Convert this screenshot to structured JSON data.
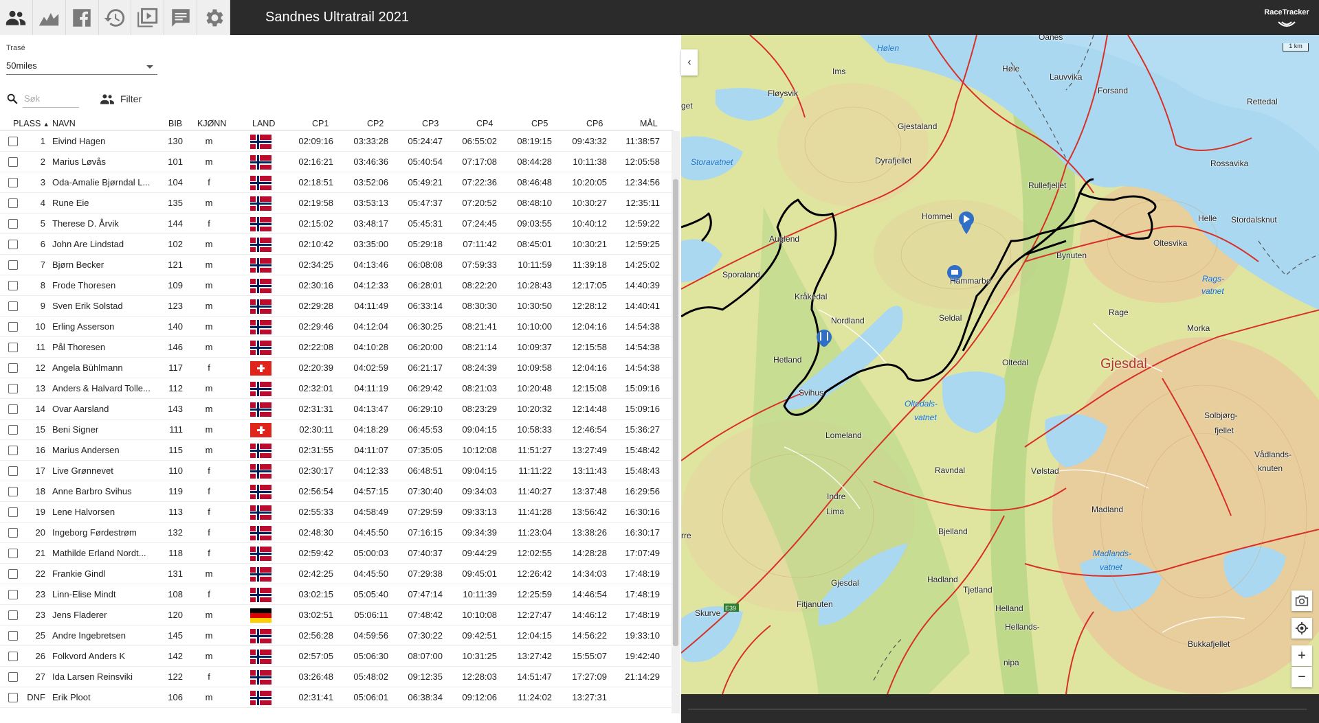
{
  "app": {
    "title": "Sandnes Ultratrail 2021",
    "brand": "RaceTracker"
  },
  "toolbar": {
    "icons": [
      "participants-icon",
      "elevation-chart-icon",
      "facebook-icon",
      "history-icon",
      "replay-icon",
      "chat-icon",
      "settings-icon"
    ]
  },
  "filters": {
    "trase_label": "Trasé",
    "trase_value": "50miles",
    "search_placeholder": "Søk",
    "filter_label": "Filter"
  },
  "table": {
    "headers": {
      "place": "PLASS",
      "name": "NAVN",
      "bib": "BIB",
      "sex": "KJØNN",
      "country": "LAND",
      "cp1": "CP1",
      "cp2": "CP2",
      "cp3": "CP3",
      "cp4": "CP4",
      "cp5": "CP5",
      "cp6": "CP6",
      "finish": "MÅL"
    },
    "rows": [
      {
        "place": "1",
        "name": "Eivind Hagen",
        "bib": "130",
        "sex": "m",
        "flag": "no",
        "cp1": "02:09:16",
        "cp2": "03:33:28",
        "cp3": "05:24:47",
        "cp4": "06:55:02",
        "cp5": "08:19:15",
        "cp6": "09:43:32",
        "finish": "11:38:57"
      },
      {
        "place": "2",
        "name": "Marius Løvås",
        "bib": "101",
        "sex": "m",
        "flag": "no",
        "cp1": "02:16:21",
        "cp2": "03:46:36",
        "cp3": "05:40:54",
        "cp4": "07:17:08",
        "cp5": "08:44:28",
        "cp6": "10:11:38",
        "finish": "12:05:58"
      },
      {
        "place": "3",
        "name": "Oda-Amalie Bjørndal L...",
        "bib": "104",
        "sex": "f",
        "flag": "no",
        "cp1": "02:18:51",
        "cp2": "03:52:06",
        "cp3": "05:49:21",
        "cp4": "07:22:36",
        "cp5": "08:46:48",
        "cp6": "10:20:05",
        "finish": "12:34:56"
      },
      {
        "place": "4",
        "name": "Rune Eie",
        "bib": "135",
        "sex": "m",
        "flag": "no",
        "cp1": "02:19:58",
        "cp2": "03:53:13",
        "cp3": "05:47:37",
        "cp4": "07:20:52",
        "cp5": "08:48:10",
        "cp6": "10:30:27",
        "finish": "12:35:11"
      },
      {
        "place": "5",
        "name": "Therese D. Årvik",
        "bib": "144",
        "sex": "f",
        "flag": "no",
        "cp1": "02:15:02",
        "cp2": "03:48:17",
        "cp3": "05:45:31",
        "cp4": "07:24:45",
        "cp5": "09:03:55",
        "cp6": "10:40:12",
        "finish": "12:59:22"
      },
      {
        "place": "6",
        "name": "John Are Lindstad",
        "bib": "102",
        "sex": "m",
        "flag": "no",
        "cp1": "02:10:42",
        "cp2": "03:35:00",
        "cp3": "05:29:18",
        "cp4": "07:11:42",
        "cp5": "08:45:01",
        "cp6": "10:30:21",
        "finish": "12:59:25"
      },
      {
        "place": "7",
        "name": "Bjørn Becker",
        "bib": "121",
        "sex": "m",
        "flag": "no",
        "cp1": "02:34:25",
        "cp2": "04:13:46",
        "cp3": "06:08:08",
        "cp4": "07:59:33",
        "cp5": "10:11:59",
        "cp6": "11:39:18",
        "finish": "14:25:02"
      },
      {
        "place": "8",
        "name": "Frode Thoresen",
        "bib": "109",
        "sex": "m",
        "flag": "no",
        "cp1": "02:30:16",
        "cp2": "04:12:33",
        "cp3": "06:28:01",
        "cp4": "08:22:20",
        "cp5": "10:28:43",
        "cp6": "12:17:05",
        "finish": "14:40:39"
      },
      {
        "place": "9",
        "name": "Sven Erik Solstad",
        "bib": "123",
        "sex": "m",
        "flag": "no",
        "cp1": "02:29:28",
        "cp2": "04:11:49",
        "cp3": "06:33:14",
        "cp4": "08:30:30",
        "cp5": "10:30:50",
        "cp6": "12:28:12",
        "finish": "14:40:41"
      },
      {
        "place": "10",
        "name": "Erling Asserson",
        "bib": "140",
        "sex": "m",
        "flag": "no",
        "cp1": "02:29:46",
        "cp2": "04:12:04",
        "cp3": "06:30:25",
        "cp4": "08:21:41",
        "cp5": "10:10:00",
        "cp6": "12:04:16",
        "finish": "14:54:38"
      },
      {
        "place": "11",
        "name": "Pål Thoresen",
        "bib": "146",
        "sex": "m",
        "flag": "no",
        "cp1": "02:22:08",
        "cp2": "04:10:28",
        "cp3": "06:20:00",
        "cp4": "08:21:14",
        "cp5": "10:09:37",
        "cp6": "12:15:58",
        "finish": "14:54:38"
      },
      {
        "place": "12",
        "name": "Angela Bühlmann",
        "bib": "117",
        "sex": "f",
        "flag": "ch",
        "cp1": "02:20:39",
        "cp2": "04:02:59",
        "cp3": "06:21:17",
        "cp4": "08:24:39",
        "cp5": "10:09:58",
        "cp6": "12:04:16",
        "finish": "14:54:38"
      },
      {
        "place": "13",
        "name": "Anders & Halvard Tolle...",
        "bib": "112",
        "sex": "m",
        "flag": "no",
        "cp1": "02:32:01",
        "cp2": "04:11:19",
        "cp3": "06:29:42",
        "cp4": "08:21:03",
        "cp5": "10:20:48",
        "cp6": "12:15:08",
        "finish": "15:09:16"
      },
      {
        "place": "14",
        "name": "Ovar Aarsland",
        "bib": "143",
        "sex": "m",
        "flag": "no",
        "cp1": "02:31:31",
        "cp2": "04:13:47",
        "cp3": "06:29:10",
        "cp4": "08:23:29",
        "cp5": "10:20:32",
        "cp6": "12:14:48",
        "finish": "15:09:16"
      },
      {
        "place": "15",
        "name": "Beni Signer",
        "bib": "111",
        "sex": "m",
        "flag": "ch",
        "cp1": "02:30:11",
        "cp2": "04:18:29",
        "cp3": "06:45:53",
        "cp4": "09:04:15",
        "cp5": "10:58:33",
        "cp6": "12:46:54",
        "finish": "15:36:27"
      },
      {
        "place": "16",
        "name": "Marius Andersen",
        "bib": "115",
        "sex": "m",
        "flag": "no",
        "cp1": "02:31:55",
        "cp2": "04:11:07",
        "cp3": "07:35:05",
        "cp4": "10:12:08",
        "cp5": "11:51:27",
        "cp6": "13:27:49",
        "finish": "15:48:42"
      },
      {
        "place": "17",
        "name": "Live Grønnevet",
        "bib": "110",
        "sex": "f",
        "flag": "no",
        "cp1": "02:30:17",
        "cp2": "04:12:33",
        "cp3": "06:48:51",
        "cp4": "09:04:15",
        "cp5": "11:11:22",
        "cp6": "13:11:43",
        "finish": "15:48:43"
      },
      {
        "place": "18",
        "name": "Anne Barbro Svihus",
        "bib": "119",
        "sex": "f",
        "flag": "no",
        "cp1": "02:56:54",
        "cp2": "04:57:15",
        "cp3": "07:30:40",
        "cp4": "09:34:03",
        "cp5": "11:40:27",
        "cp6": "13:37:48",
        "finish": "16:29:56"
      },
      {
        "place": "19",
        "name": "Lene Halvorsen",
        "bib": "113",
        "sex": "f",
        "flag": "no",
        "cp1": "02:55:33",
        "cp2": "04:58:49",
        "cp3": "07:29:59",
        "cp4": "09:33:13",
        "cp5": "11:41:28",
        "cp6": "13:56:42",
        "finish": "16:30:16"
      },
      {
        "place": "20",
        "name": "Ingeborg Førdestrøm",
        "bib": "132",
        "sex": "f",
        "flag": "no",
        "cp1": "02:48:30",
        "cp2": "04:45:50",
        "cp3": "07:16:15",
        "cp4": "09:34:39",
        "cp5": "11:23:04",
        "cp6": "13:38:26",
        "finish": "16:30:17"
      },
      {
        "place": "21",
        "name": "Mathilde Erland Nordt...",
        "bib": "118",
        "sex": "f",
        "flag": "no",
        "cp1": "02:59:42",
        "cp2": "05:00:03",
        "cp3": "07:40:37",
        "cp4": "09:44:29",
        "cp5": "12:02:55",
        "cp6": "14:28:28",
        "finish": "17:07:49"
      },
      {
        "place": "22",
        "name": "Frankie Gindl",
        "bib": "131",
        "sex": "m",
        "flag": "no",
        "cp1": "02:42:25",
        "cp2": "04:45:50",
        "cp3": "07:29:38",
        "cp4": "09:45:01",
        "cp5": "12:26:42",
        "cp6": "14:34:03",
        "finish": "17:48:19"
      },
      {
        "place": "23",
        "name": "Linn-Elise Mindt",
        "bib": "108",
        "sex": "f",
        "flag": "no",
        "cp1": "03:02:15",
        "cp2": "05:05:40",
        "cp3": "07:47:14",
        "cp4": "10:11:39",
        "cp5": "12:25:59",
        "cp6": "14:46:54",
        "finish": "17:48:19"
      },
      {
        "place": "23",
        "name": "Jens Fladerer",
        "bib": "120",
        "sex": "m",
        "flag": "de",
        "cp1": "03:02:51",
        "cp2": "05:06:11",
        "cp3": "07:48:42",
        "cp4": "10:10:08",
        "cp5": "12:27:47",
        "cp6": "14:46:12",
        "finish": "17:48:19"
      },
      {
        "place": "25",
        "name": "Andre Ingebretsen",
        "bib": "145",
        "sex": "m",
        "flag": "no",
        "cp1": "02:56:28",
        "cp2": "04:59:56",
        "cp3": "07:30:22",
        "cp4": "09:42:51",
        "cp5": "12:04:15",
        "cp6": "14:56:22",
        "finish": "19:33:10"
      },
      {
        "place": "26",
        "name": "Folkvord Anders K",
        "bib": "142",
        "sex": "m",
        "flag": "no",
        "cp1": "02:57:05",
        "cp2": "05:06:30",
        "cp3": "08:07:00",
        "cp4": "10:31:25",
        "cp5": "13:27:42",
        "cp6": "15:55:07",
        "finish": "19:42:40"
      },
      {
        "place": "27",
        "name": "Ida Larsen Reinsviki",
        "bib": "122",
        "sex": "f",
        "flag": "no",
        "cp1": "03:26:48",
        "cp2": "05:48:02",
        "cp3": "09:12:35",
        "cp4": "12:28:03",
        "cp5": "14:51:47",
        "cp6": "17:27:09",
        "finish": "21:14:29"
      },
      {
        "place": "DNF",
        "name": "Erik Ploot",
        "bib": "106",
        "sex": "m",
        "flag": "no",
        "cp1": "02:31:41",
        "cp2": "05:06:01",
        "cp3": "06:38:34",
        "cp4": "09:12:06",
        "cp5": "11:24:02",
        "cp6": "13:27:31",
        "finish": ""
      }
    ]
  },
  "map": {
    "scale_label": "1 km",
    "places": [
      {
        "name": "Oanes",
        "kind": "land"
      },
      {
        "name": "Hølen",
        "kind": "water"
      },
      {
        "name": "Ims",
        "kind": "land"
      },
      {
        "name": "Høle",
        "kind": "land"
      },
      {
        "name": "Lauvvika",
        "kind": "land"
      },
      {
        "name": "Forsand",
        "kind": "land"
      },
      {
        "name": "Rettedal",
        "kind": "land"
      },
      {
        "name": "Fløysvik",
        "kind": "land"
      },
      {
        "name": "Gjestaland",
        "kind": "land"
      },
      {
        "name": "Dyrafjellet",
        "kind": "land"
      },
      {
        "name": "Rossavika",
        "kind": "land"
      },
      {
        "name": "Storavatnet",
        "kind": "water"
      },
      {
        "name": "Rullefjellet",
        "kind": "land"
      },
      {
        "name": "Hommel",
        "kind": "land"
      },
      {
        "name": "Helle",
        "kind": "land"
      },
      {
        "name": "Stordalsknut",
        "kind": "land"
      },
      {
        "name": "Auglend",
        "kind": "land"
      },
      {
        "name": "Oltesvika",
        "kind": "land"
      },
      {
        "name": "Bynuten",
        "kind": "land"
      },
      {
        "name": "Sporaland",
        "kind": "land"
      },
      {
        "name": "Hammarbø",
        "kind": "land"
      },
      {
        "name": "Rags-",
        "kind": "water"
      },
      {
        "name": "vatnet",
        "kind": "water"
      },
      {
        "name": "Kråkedal",
        "kind": "land"
      },
      {
        "name": "Nordland",
        "kind": "land"
      },
      {
        "name": "Seldal",
        "kind": "land"
      },
      {
        "name": "Rage",
        "kind": "land"
      },
      {
        "name": "Morka",
        "kind": "land"
      },
      {
        "name": "Hetland",
        "kind": "land"
      },
      {
        "name": "Oltedal",
        "kind": "land"
      },
      {
        "name": "Gjesdal",
        "kind": "big"
      },
      {
        "name": "Svihus",
        "kind": "land"
      },
      {
        "name": "Oltedals-",
        "kind": "water"
      },
      {
        "name": "vatnet",
        "kind": "water"
      },
      {
        "name": "Solbjørg-",
        "kind": "land"
      },
      {
        "name": "fjellet",
        "kind": "land"
      },
      {
        "name": "Lomeland",
        "kind": "land"
      },
      {
        "name": "Vådlands-",
        "kind": "land"
      },
      {
        "name": "knuten",
        "kind": "land"
      },
      {
        "name": "Ravndal",
        "kind": "land"
      },
      {
        "name": "Vølstad",
        "kind": "land"
      },
      {
        "name": "Indre",
        "kind": "land"
      },
      {
        "name": "Lima",
        "kind": "land"
      },
      {
        "name": "Madland",
        "kind": "land"
      },
      {
        "name": "Bjelland",
        "kind": "land"
      },
      {
        "name": "Madlands-",
        "kind": "water"
      },
      {
        "name": "vatnet",
        "kind": "water"
      },
      {
        "name": "Hadland",
        "kind": "land"
      },
      {
        "name": "Gjesdal",
        "kind": "land"
      },
      {
        "name": "Tjetland",
        "kind": "land"
      },
      {
        "name": "Fitjanuten",
        "kind": "land"
      },
      {
        "name": "Helland",
        "kind": "land"
      },
      {
        "name": "Skurve",
        "kind": "land"
      },
      {
        "name": "Hellands-",
        "kind": "land"
      },
      {
        "name": "Bukkafjellet",
        "kind": "land"
      },
      {
        "name": "nipa",
        "kind": "land"
      },
      {
        "name": "rre",
        "kind": "land"
      },
      {
        "name": "get",
        "kind": "land"
      }
    ]
  }
}
